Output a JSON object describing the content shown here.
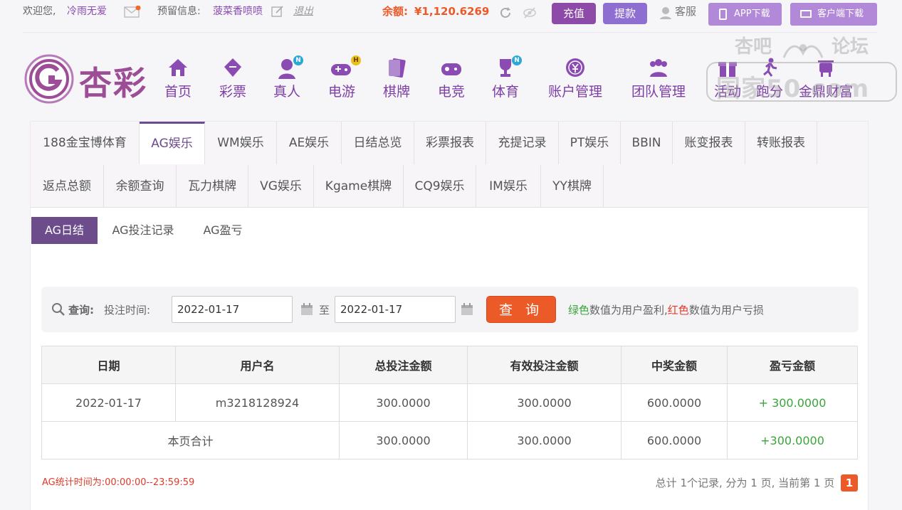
{
  "top": {
    "welcome": "欢迎您,",
    "username": "冷雨无爱",
    "reserved_label": "预留信息:",
    "reserved_value": "菠菜香喷喷",
    "logout": "退出",
    "balance_label": "余额:",
    "balance_value": "¥1,120.6269",
    "recharge": "充值",
    "withdraw": "提款",
    "service": "客服",
    "app_download": "APP下载",
    "client_download": "客户端下载"
  },
  "logo_text": "杏彩",
  "nav": [
    {
      "label": "首页",
      "icon": "home-icon"
    },
    {
      "label": "彩票",
      "icon": "lottery-icon"
    },
    {
      "label": "真人",
      "icon": "live-dealer-icon",
      "badge": "N"
    },
    {
      "label": "电游",
      "icon": "gamepad-icon",
      "badge": "H"
    },
    {
      "label": "棋牌",
      "icon": "cards-icon"
    },
    {
      "label": "电竞",
      "icon": "esports-icon"
    },
    {
      "label": "体育",
      "icon": "trophy-icon",
      "badge": "N"
    },
    {
      "label": "账户管理",
      "icon": "coin-icon"
    },
    {
      "label": "团队管理",
      "icon": "team-icon"
    },
    {
      "label": "活动",
      "icon": "gift-icon"
    },
    {
      "label": "跑分",
      "icon": "run-icon"
    },
    {
      "label": "金鼎财富",
      "icon": "wealth-icon"
    }
  ],
  "watermark": {
    "line1": "杏吧",
    "line2": "论坛",
    "line3": "国家50.com"
  },
  "tabs_row1": [
    "188金宝博体育",
    "AG娱乐",
    "WM娱乐",
    "AE娱乐",
    "日结总览",
    "彩票报表",
    "充提记录",
    "PT娱乐",
    "BBIN",
    "账变报表",
    "转账报表"
  ],
  "tabs_row2": [
    "返点总额",
    "余额查询",
    "瓦力棋牌",
    "VG娱乐",
    "Kgame棋牌",
    "CQ9娱乐",
    "IM娱乐",
    "YY棋牌"
  ],
  "subtabs": [
    "AG日结",
    "AG投注记录",
    "AG盈亏"
  ],
  "query": {
    "label": "查询:",
    "time_label": "投注时间:",
    "start_date": "2022-01-17",
    "to": "至",
    "end_date": "2022-01-17",
    "button": "查 询",
    "hint_green": "绿色",
    "hint_mid": "数值为用户盈利,",
    "hint_red": "红色",
    "hint_end": "数值为用户亏损"
  },
  "table": {
    "headers": [
      "日期",
      "用户名",
      "总投注金额",
      "有效投注金额",
      "中奖金额",
      "盈亏金额"
    ],
    "row": [
      "2022-01-17",
      "m3218128924",
      "300.0000",
      "300.0000",
      "600.0000",
      "+ 300.0000"
    ],
    "total": [
      "本页合计",
      "300.0000",
      "300.0000",
      "600.0000",
      "+300.0000"
    ]
  },
  "footer": {
    "note": "AG统计时间为:00:00:00--23:59:59",
    "pager_text": "总计 1个记录, 分为 1 页, 当前第 1 页",
    "current_page": "1"
  },
  "colors": {
    "purple": "#7d3fa5",
    "accent": "#ec5a27",
    "green": "#3aa53a",
    "red": "#e03a2b"
  }
}
